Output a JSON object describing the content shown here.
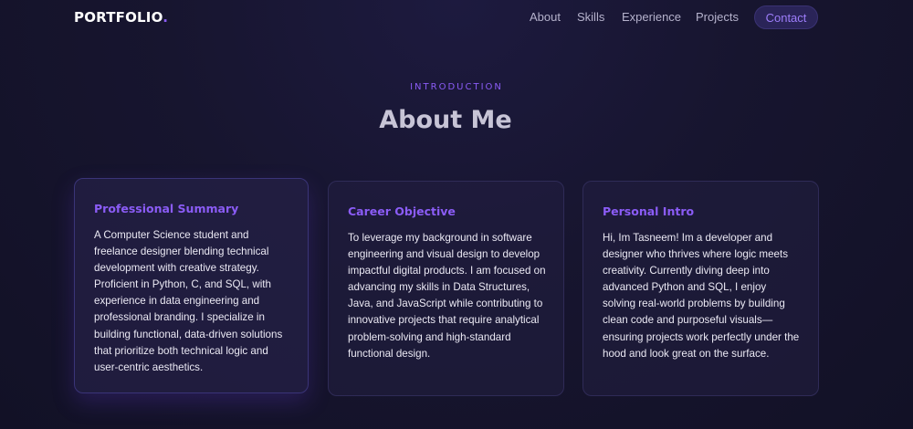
{
  "nav": {
    "logo_text": "PORTFOLIO",
    "logo_dot": ".",
    "links": [
      {
        "label": "About"
      },
      {
        "label": "Skills"
      },
      {
        "label": "Experience"
      },
      {
        "label": "Projects"
      }
    ],
    "contact_label": "Contact"
  },
  "section": {
    "eyebrow": "INTRODUCTION",
    "title": "About Me"
  },
  "cards": [
    {
      "title": "Professional Summary",
      "body": "A Computer Science student and freelance designer blending technical development with creative strategy. Proficient in Python, C, and SQL, with experience in data engineering and professional branding. I specialize in building functional, data-driven solutions that prioritize both technical logic and user-centric aesthetics."
    },
    {
      "title": "Career Objective",
      "body": "To leverage my background in software engineering and visual design to develop impactful digital products. I am focused on advancing my skills in Data Structures, Java, and JavaScript while contributing to innovative projects that require analytical problem-solving and high-standard functional design."
    },
    {
      "title": "Personal Intro",
      "body": "Hi, Im Tasneem! Im a developer and designer who thrives where logic meets creativity. Currently diving deep into advanced Python and SQL, I enjoy solving real-world problems by building clean code and purposeful visuals—ensuring projects work perfectly under the hood and look great on the surface."
    }
  ],
  "colors": {
    "accent": "#8b5cf6",
    "background": "#17152f",
    "card_border": "#2f2b57"
  }
}
